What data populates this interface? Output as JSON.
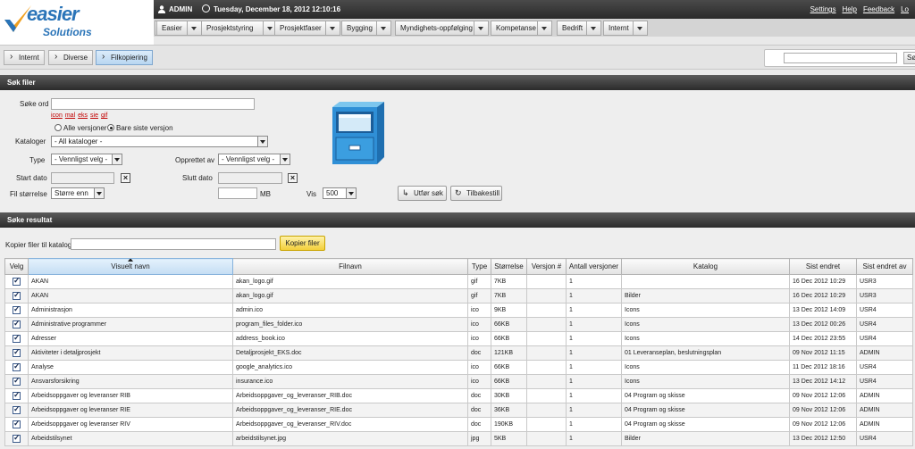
{
  "logo": {
    "line1": "easier",
    "line2": "Solutions"
  },
  "topbar": {
    "user": "ADMIN",
    "datetime": "Tuesday, December 18, 2012 12:10:16",
    "links": [
      "Settings",
      "Help",
      "Feedback",
      "Lo"
    ]
  },
  "menu": [
    {
      "label": "Easier"
    },
    {
      "label": "Prosjektstyring"
    },
    {
      "label": "Prosjektfaser"
    },
    {
      "label": "Bygging"
    },
    {
      "label": "Myndighets-oppfølging"
    },
    {
      "label": "Kompetanse"
    },
    {
      "label": "Bedrift"
    },
    {
      "label": "Internt"
    }
  ],
  "breadcrumb": [
    "Internt",
    "Diverse",
    "Filkopiering"
  ],
  "top_search": {
    "button": "Søk"
  },
  "search_section": {
    "title": "Søk filer",
    "keyword_label": "Søke ord",
    "quick_types": [
      "icon",
      "mal",
      "eks",
      "sie",
      "gif"
    ],
    "version_all": "Alle versjoner",
    "version_latest": "Bare siste versjon",
    "catalog_label": "Kataloger",
    "catalog_value": "- All kataloger -",
    "type_label": "Type",
    "type_value": "- Vennligst velg -",
    "created_by_label": "Opprettet av",
    "created_by_value": "- Vennligst velg -",
    "start_label": "Start dato",
    "end_label": "Slutt dato",
    "size_label": "Fil størrelse",
    "size_value": "Større enn",
    "mb_label": "MB",
    "show_label": "Vis",
    "show_value": "500",
    "search_button": "Utfør søk",
    "reset_button": "Tilbakestill"
  },
  "results_section": {
    "title": "Søke resultat",
    "copy_label": "Kopier filer til katalog",
    "copy_button": "Kopier filer",
    "columns": [
      "Velg",
      "Visuelt navn",
      "Filnavn",
      "Type",
      "Størrelse",
      "Versjon #",
      "Antall versjoner",
      "Katalog",
      "Sist endret",
      "Sist endret av"
    ],
    "rows": [
      [
        "AKAN",
        "akan_logo.gif",
        "gif",
        "7KB",
        "",
        "1",
        "",
        "16 Dec 2012 10:29",
        "USR3"
      ],
      [
        "AKAN",
        "akan_logo.gif",
        "gif",
        "7KB",
        "",
        "1",
        "Bilder",
        "16 Dec 2012 10:29",
        "USR3"
      ],
      [
        "Administrasjon",
        "admin.ico",
        "ico",
        "9KB",
        "",
        "1",
        "Icons",
        "13 Dec 2012 14:09",
        "USR4"
      ],
      [
        "Administrative programmer",
        "program_files_folder.ico",
        "ico",
        "66KB",
        "",
        "1",
        "Icons",
        "13 Dec 2012 00:26",
        "USR4"
      ],
      [
        "Adresser",
        "address_book.ico",
        "ico",
        "66KB",
        "",
        "1",
        "Icons",
        "14 Dec 2012 23:55",
        "USR4"
      ],
      [
        "Aktiviteter i detaljprosjekt",
        "Detaljprosjekt_EKS.doc",
        "doc",
        "121KB",
        "",
        "1",
        "01 Leveranseplan, beslutningsplan",
        "09 Nov 2012 11:15",
        "ADMIN"
      ],
      [
        "Analyse",
        "google_analytics.ico",
        "ico",
        "66KB",
        "",
        "1",
        "Icons",
        "11 Dec 2012 18:16",
        "USR4"
      ],
      [
        "Ansvarsforsikring",
        "insurance.ico",
        "ico",
        "66KB",
        "",
        "1",
        "Icons",
        "13 Dec 2012 14:12",
        "USR4"
      ],
      [
        "Arbeidsoppgaver og leveranser RIB",
        "Arbeidsoppgaver_og_leveranser_RIB.doc",
        "doc",
        "30KB",
        "",
        "1",
        "04 Program og skisse",
        "09 Nov 2012 12:06",
        "ADMIN"
      ],
      [
        "Arbeidsoppgaver og leveranser RIE",
        "Arbeidsoppgaver_og_leveranser_RIE.doc",
        "doc",
        "36KB",
        "",
        "1",
        "04 Program og skisse",
        "09 Nov 2012 12:06",
        "ADMIN"
      ],
      [
        "Arbeidsoppgaver og leveranser RIV",
        "Arbeidsoppgaver_og_leveranser_RIV.doc",
        "doc",
        "190KB",
        "",
        "1",
        "04 Program og skisse",
        "09 Nov 2012 12:06",
        "ADMIN"
      ],
      [
        "Arbeidstilsynet",
        "arbeidstilsynet.jpg",
        "jpg",
        "5KB",
        "",
        "1",
        "Bilder",
        "13 Dec 2012 12:50",
        "USR4"
      ]
    ]
  }
}
